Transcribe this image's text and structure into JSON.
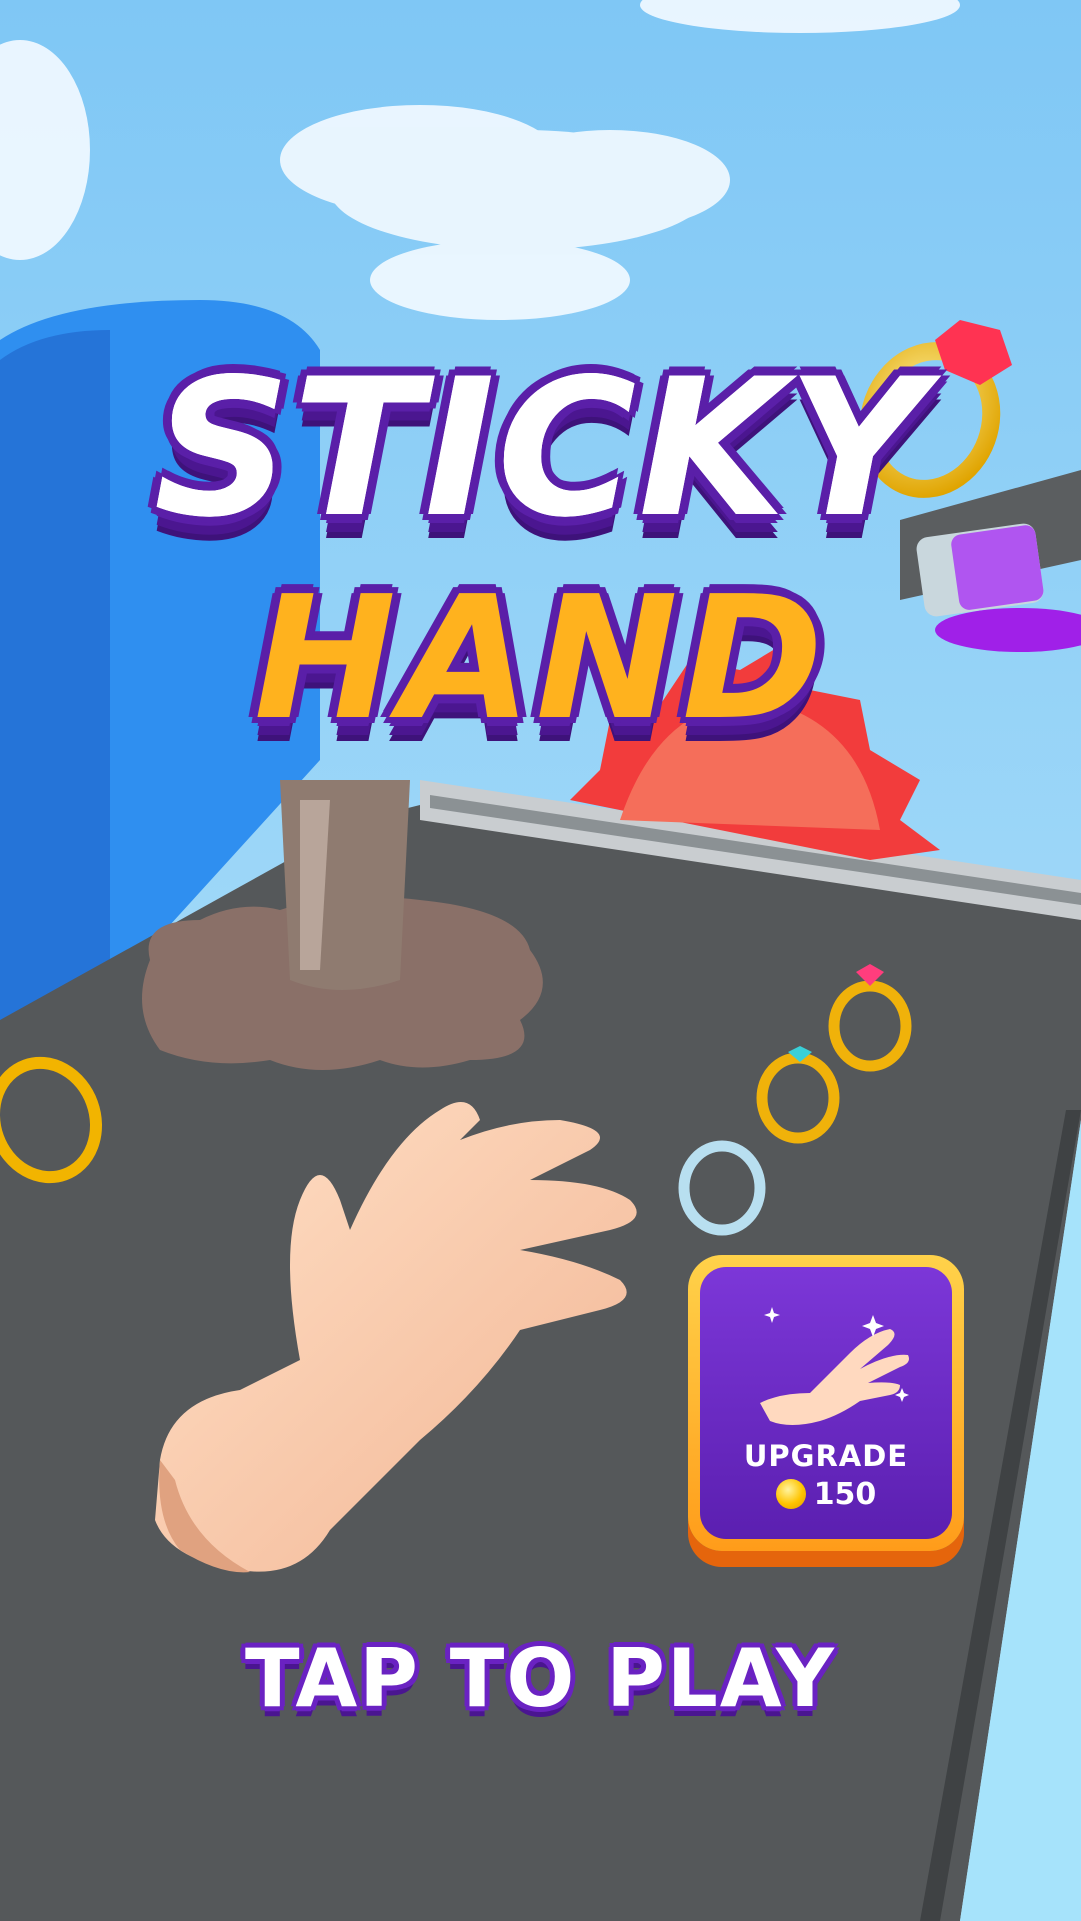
{
  "game": {
    "title_line1": "STICKY",
    "title_line2": "HAND"
  },
  "upgrade": {
    "label": "UPGRADE",
    "cost": "150",
    "icon": "hand-icon",
    "currency_icon": "coin-icon"
  },
  "prompt": {
    "tap_to_play": "TAP TO PLAY"
  },
  "colors": {
    "sky": "#9ad6f7",
    "track": "#55585a",
    "title_white": "#ffffff",
    "title_orange": "#ffb21e",
    "title_outline": "#5a1fa8",
    "card_border": "#ffb81f",
    "card_fill": "#6a2bc6"
  }
}
